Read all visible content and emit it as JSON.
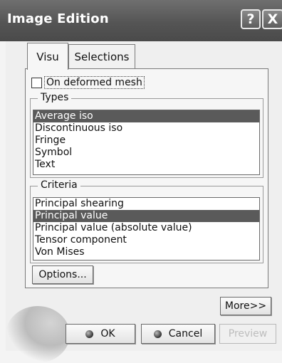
{
  "window": {
    "title": "Image Edition",
    "help_glyph": "?",
    "close_glyph": "X"
  },
  "tabs": [
    {
      "label": "Visu",
      "active": true
    },
    {
      "label": "Selections",
      "active": false
    }
  ],
  "visu": {
    "checkbox": {
      "label": "On deformed mesh",
      "checked": false
    },
    "types": {
      "legend": "Types",
      "items": [
        "Average iso",
        "Discontinuous iso",
        "Fringe",
        "Symbol",
        "Text"
      ],
      "selected": "Average iso"
    },
    "criteria": {
      "legend": "Criteria",
      "items": [
        "Principal shearing",
        "Principal value",
        "Principal value (absolute value)",
        "Tensor component",
        "Von Mises"
      ],
      "selected": "Principal value"
    },
    "options_label": "Options..."
  },
  "buttons": {
    "more": "More>>",
    "ok": "OK",
    "cancel": "Cancel",
    "preview": "Preview"
  }
}
